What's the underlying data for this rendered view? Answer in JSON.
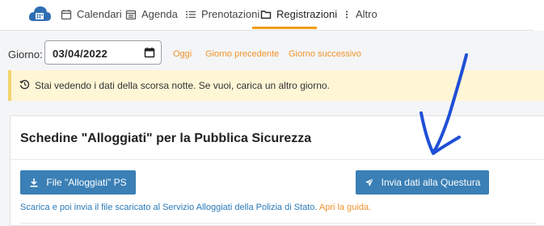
{
  "nav": {
    "items": [
      {
        "label": "Calendari",
        "icon": "calendar-blank-icon"
      },
      {
        "label": "Agenda",
        "icon": "agenda-icon"
      },
      {
        "label": "Prenotazioni",
        "icon": "list-icon"
      },
      {
        "label": "Registrazioni",
        "icon": "folder-icon"
      },
      {
        "label": "Altro",
        "icon": "vertical-dots-icon"
      }
    ],
    "active": "Registrazioni",
    "accent": "#f39c12"
  },
  "date_bar": {
    "label": "Giorno:",
    "value": "03/04/2022",
    "links": [
      "Oggi",
      "Giorno precedente",
      "Giorno successivo"
    ]
  },
  "alert": {
    "text": "Stai vedendo i dati della scorsa notte. Se vuoi, carica un altro giorno."
  },
  "card": {
    "title": "Schedine \"Alloggiati\" per la Pubblica Sicurezza",
    "download_label": "File \"Alloggiati\" PS",
    "send_label": "Invia dati alla Questura",
    "note_text": "Scarica e poi invia il file scaricato al Servizio Alloggiati della Polizia di Stato.",
    "note_link": "Apri la guida."
  },
  "colors": {
    "button": "#3a7fb5",
    "link": "#f0932b",
    "alert_bg": "#fff6d6",
    "annotation_arrow": "#1f4fd6"
  }
}
